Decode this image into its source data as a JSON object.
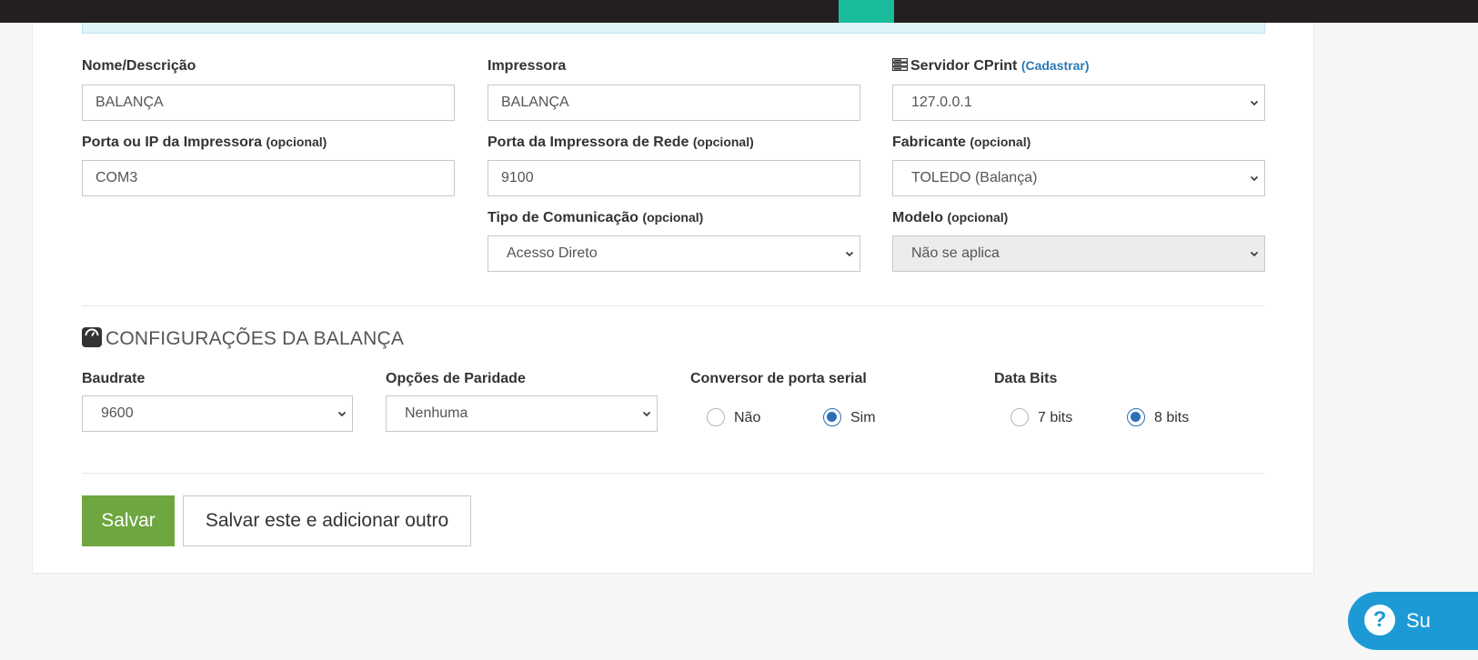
{
  "topbar": {
    "cut_text": "… … …"
  },
  "form": {
    "nome": {
      "label": "Nome/Descrição",
      "value": "BALANÇA"
    },
    "impressora": {
      "label": "Impressora",
      "value": "BALANÇA"
    },
    "servidor": {
      "label": "Servidor CPrint",
      "link": "(Cadastrar)",
      "value": "127.0.0.1",
      "icon": "server-icon"
    },
    "porta_ip": {
      "label": "Porta ou IP da Impressora",
      "optional": "(opcional)",
      "value": "COM3"
    },
    "porta_rede": {
      "label": "Porta da Impressora de Rede",
      "optional": "(opcional)",
      "value": "9100"
    },
    "fabricante": {
      "label": "Fabricante",
      "optional": "(opcional)",
      "value": "TOLEDO (Balança)"
    },
    "tipo_comunicacao": {
      "label": "Tipo de Comunicação",
      "optional": "(opcional)",
      "value": "Acesso Direto"
    },
    "modelo": {
      "label": "Modelo",
      "optional": "(opcional)",
      "value": "Não se aplica"
    }
  },
  "balanca": {
    "title": "CONFIGURAÇÕES DA BALANÇA",
    "icon": "scale-icon",
    "baudrate": {
      "label": "Baudrate",
      "value": "9600"
    },
    "paridade": {
      "label": "Opções de Paridade",
      "value": "Nenhuma"
    },
    "conversor": {
      "label": "Conversor de porta serial",
      "options": [
        "Não",
        "Sim"
      ],
      "selected": "Sim"
    },
    "data_bits": {
      "label": "Data Bits",
      "options": [
        "7 bits",
        "8 bits"
      ],
      "selected": "8 bits"
    }
  },
  "actions": {
    "save": "Salvar",
    "save_add": "Salvar este e adicionar outro"
  },
  "support": {
    "label": "Su"
  },
  "colors": {
    "accent_teal": "#1abc9c",
    "save_green": "#6ea63f",
    "radio_blue": "#2a6fb8",
    "support_blue": "#1d9ad6"
  }
}
